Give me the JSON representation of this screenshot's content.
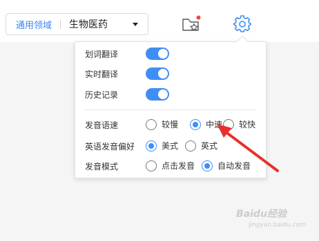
{
  "domain_selector": {
    "label": "通用领域",
    "value": "生物医药"
  },
  "toolbar": {
    "favorites_icon": "star-folder-icon",
    "settings_icon": "gear-icon",
    "accent_color": "#3f8ef5"
  },
  "settings": {
    "toggles": [
      {
        "label": "划词翻译",
        "on": true
      },
      {
        "label": "实时翻译",
        "on": true
      },
      {
        "label": "历史记录",
        "on": true
      }
    ],
    "speed": {
      "label": "发音语速",
      "options": [
        "较慢",
        "中速",
        "较快"
      ],
      "selected": "中速"
    },
    "accent": {
      "label": "英语发音偏好",
      "options": [
        "美式",
        "英式"
      ],
      "selected": "美式"
    },
    "mode": {
      "label": "发音模式",
      "options": [
        "点击发音",
        "自动发音"
      ],
      "selected": "自动发音"
    }
  },
  "watermark": {
    "text": "Baidu经验",
    "sub": "jingyan.baidu.com"
  }
}
